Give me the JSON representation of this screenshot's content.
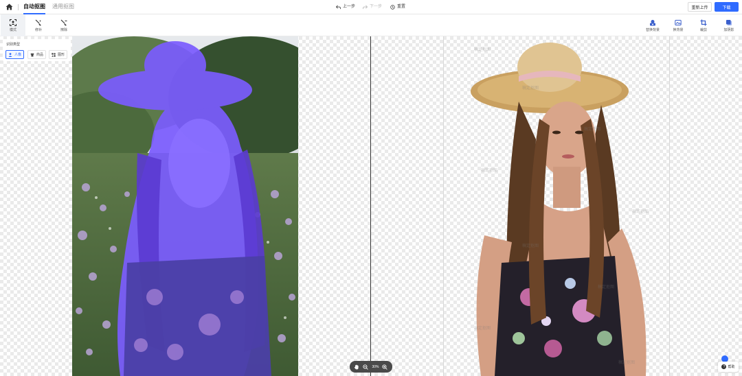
{
  "header": {
    "tabs": [
      {
        "label": "自动抠图",
        "active": true
      },
      {
        "label": "通用抠图",
        "active": false
      }
    ],
    "history": {
      "undo": "上一步",
      "redo": "下一步",
      "reset": "重置"
    },
    "reupload_label": "重新上传",
    "download_label": "下载"
  },
  "toolbar": {
    "left": [
      {
        "label": "模式",
        "icon": "mode-icon"
      },
      {
        "label": "修补",
        "icon": "repair-brush-icon"
      },
      {
        "label": "擦除",
        "icon": "erase-brush-icon"
      }
    ],
    "right": [
      {
        "label": "替换背景",
        "icon": "replace-background-icon"
      },
      {
        "label": "换背景",
        "icon": "background-icon"
      },
      {
        "label": "裁剪",
        "icon": "crop-icon"
      },
      {
        "label": "加阴影",
        "icon": "shadow-icon"
      }
    ]
  },
  "recognition_panel": {
    "title": "识别类型",
    "options": [
      {
        "label": "人像",
        "icon": "person-icon",
        "selected": true
      },
      {
        "label": "商品",
        "icon": "product-icon",
        "selected": false
      },
      {
        "label": "图形",
        "icon": "graphic-icon",
        "selected": false
      }
    ]
  },
  "zoom": {
    "value": "30%"
  },
  "help_label": "帮助",
  "watermark_text": "稿定抠图",
  "colors": {
    "accent": "#2f6bff",
    "mask_overlay": "#7b5cff",
    "zoom_bar": "#4a4a4a"
  }
}
